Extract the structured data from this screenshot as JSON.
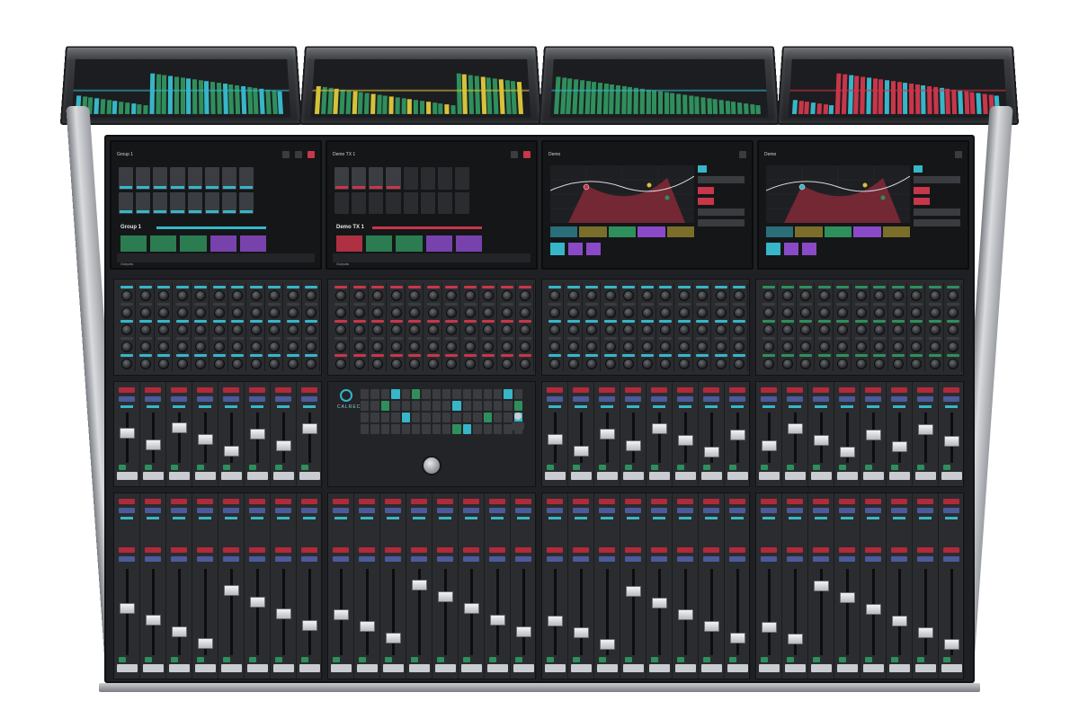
{
  "product": {
    "brand_text": "CALREC",
    "vertical_brand_text": "CALREC"
  },
  "screens": [
    {
      "id": "screen-1",
      "header_title": "Group 1",
      "label": "Group 1",
      "footer": "Outputs",
      "accent": "#36b6c8"
    },
    {
      "id": "screen-2",
      "header_title": "Demo TX 1",
      "label": "Demo TX 1",
      "footer": "Outputs",
      "accent": "#c8364a"
    },
    {
      "id": "screen-3",
      "header_title": "Demo",
      "label": "",
      "footer": "",
      "accent": "#36b6c8"
    },
    {
      "id": "screen-4",
      "header_title": "Demo",
      "label": "",
      "footer": "",
      "accent": "#36b6c8"
    }
  ],
  "colors": {
    "cyan": "#36b6c8",
    "red": "#c8364a",
    "green": "#2f8f5c",
    "purple": "#8a4ac8",
    "yellow": "#d6c23a",
    "surface": "#1f2023"
  },
  "icons": {
    "brand": "calrec-logo-icon",
    "jog": "jog-wheel-icon",
    "joystick": "joystick-icon"
  }
}
